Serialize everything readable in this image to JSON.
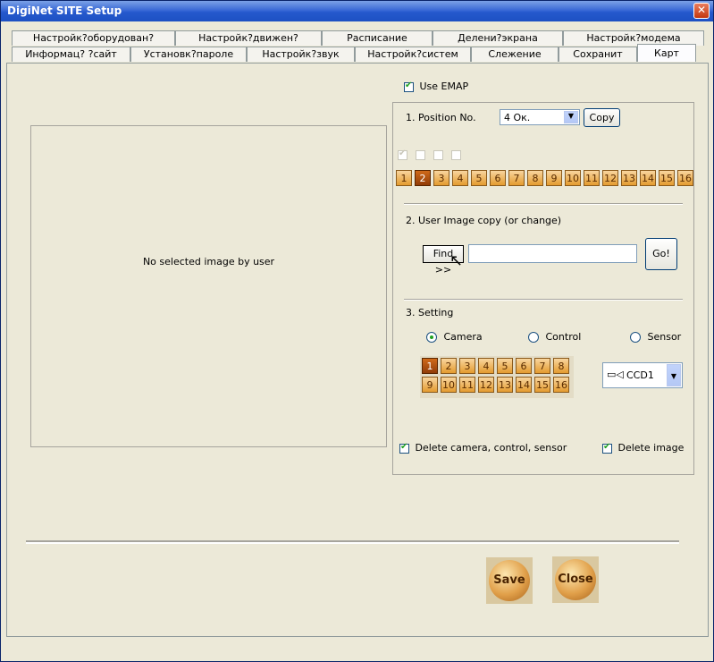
{
  "window": {
    "title": "DigiNet SITE Setup"
  },
  "tabs_row1": [
    "Настройк?оборудован?",
    "Настройк?движен?",
    "Расписание",
    "Делени?экрана",
    "Настройк?модема"
  ],
  "tabs_row2": [
    "Информац? ?сайт",
    "Установк?пароле",
    "Настройк?звук",
    "Настройк?систем",
    "Слежение",
    "Сохранит",
    "Карт"
  ],
  "image_area": {
    "placeholder": "No selected image by user"
  },
  "use_emap": {
    "label": "Use EMAP",
    "checked": true
  },
  "position": {
    "label": "1. Position No.",
    "selected": "4 Ок.",
    "copy_label": "Copy"
  },
  "position_checks": [
    true,
    false,
    false,
    false
  ],
  "position_numbers": [
    "1",
    "2",
    "3",
    "4",
    "5",
    "6",
    "7",
    "8",
    "9",
    "10",
    "11",
    "12",
    "13",
    "14",
    "15",
    "16"
  ],
  "position_selected": "2",
  "user_image": {
    "label": "2. User Image copy (or change)",
    "find_label": "Find >>",
    "path_value": "",
    "go_label": "Go!"
  },
  "setting": {
    "label": "3. Setting",
    "radios": [
      {
        "label": "Camera",
        "checked": true
      },
      {
        "label": "Control",
        "checked": false
      },
      {
        "label": "Sensor",
        "checked": false
      }
    ],
    "camera_numbers": [
      "1",
      "2",
      "3",
      "4",
      "5",
      "6",
      "7",
      "8",
      "9",
      "10",
      "11",
      "12",
      "13",
      "14",
      "15",
      "16"
    ],
    "camera_selected": "1",
    "camera_select": "CCD1"
  },
  "delete_items": {
    "label": "Delete camera, control, sensor",
    "checked": true
  },
  "delete_image": {
    "label": "Delete image",
    "checked": true
  },
  "buttons": {
    "save": "Save",
    "close": "Close"
  }
}
